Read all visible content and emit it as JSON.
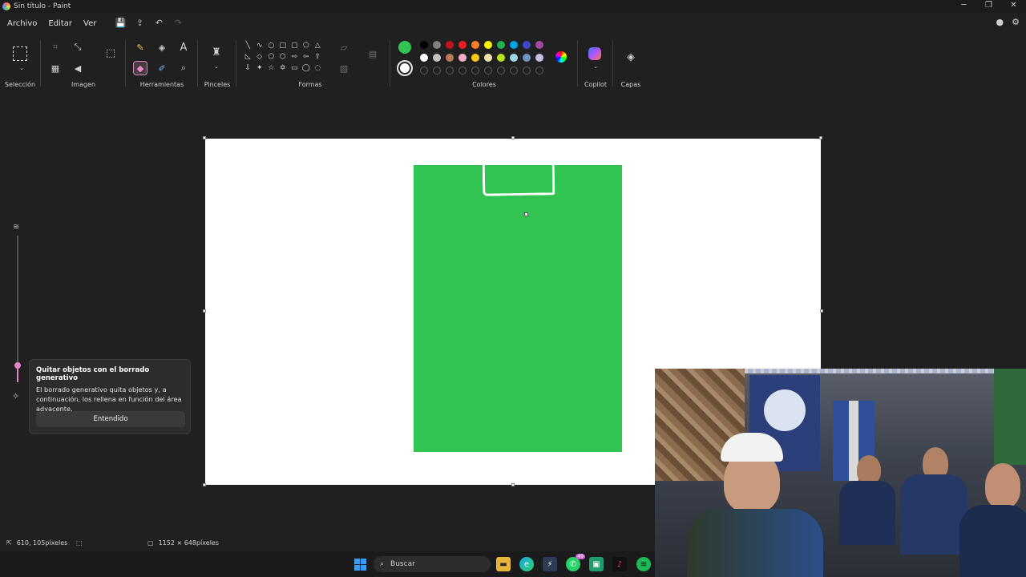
{
  "window": {
    "title": "Sin título - Paint",
    "controls": [
      "─",
      "❐",
      "✕"
    ]
  },
  "menu": {
    "archivo": "Archivo",
    "editar": "Editar",
    "ver": "Ver"
  },
  "ribbon": {
    "groups": {
      "seleccion": "Selección",
      "imagen": "Imagen",
      "herramientas": "Herramientas",
      "pinceles": "Pinceles",
      "formas": "Formas",
      "colores": "Colores",
      "copilot": "Copilot",
      "capas": "Capas"
    },
    "active_tool": "eraser",
    "primary_color": "#31c452",
    "secondary_color": "#ffffff",
    "palette_row1": [
      "#000000",
      "#7f7f7f",
      "#c3121f",
      "#ec1c24",
      "#ff7f27",
      "#fff200",
      "#22b14c",
      "#00a2e8",
      "#3f48cc",
      "#a349a4"
    ],
    "palette_row2": [
      "#ffffff",
      "#c3c3c3",
      "#b97a57",
      "#ffaec9",
      "#ffc90e",
      "#efe4b0",
      "#b5e61d",
      "#99d9ea",
      "#7092be",
      "#c8bfe7"
    ]
  },
  "popup": {
    "title": "Quitar objetos con el borrado generativo",
    "body": "El borrado generativo quita objetos y, a continuación, los rellena en función del área adyacente.",
    "button": "Entendido"
  },
  "status": {
    "cursor": "610, 105píxeles",
    "canvas_size": "1152 × 648píxeles"
  },
  "taskbar": {
    "search_placeholder": "Buscar",
    "whatsapp_badge": "49"
  }
}
